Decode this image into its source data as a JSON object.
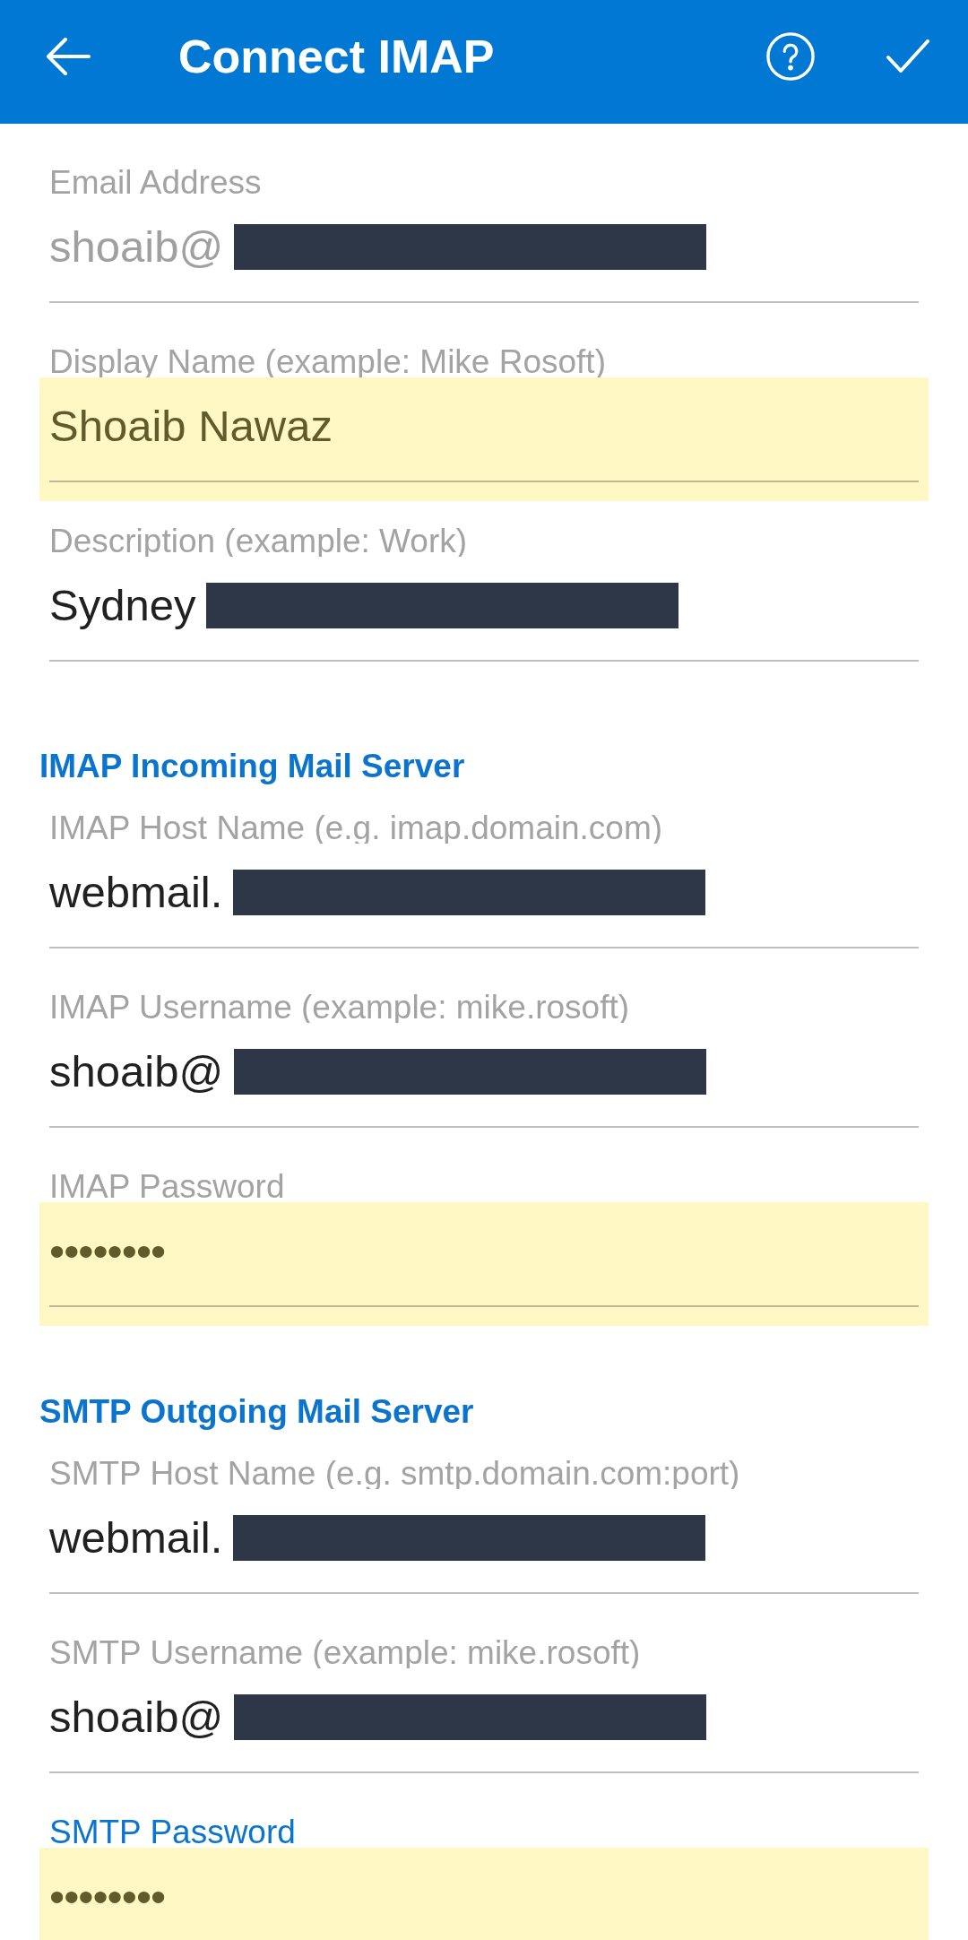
{
  "app_bar": {
    "title": "Connect IMAP"
  },
  "sections": [
    {
      "fields": [
        {
          "label": "Email Address",
          "value": "shoaib@",
          "kind": "text",
          "disabled": true,
          "autofilled": false,
          "focused": false,
          "redacted": true
        },
        {
          "label": "Display Name (example: Mike Rosoft)",
          "value": "Shoaib Nawaz",
          "kind": "text",
          "disabled": false,
          "autofilled": true,
          "focused": false,
          "redacted": false
        },
        {
          "label": "Description (example: Work)",
          "value": "Sydney",
          "kind": "text",
          "disabled": false,
          "autofilled": false,
          "focused": false,
          "redacted": true
        }
      ]
    },
    {
      "heading": "IMAP Incoming Mail Server",
      "fields": [
        {
          "label": "IMAP Host Name (e.g. imap.domain.com)",
          "value": "webmail.",
          "kind": "text",
          "disabled": false,
          "autofilled": false,
          "focused": false,
          "redacted": true
        },
        {
          "label": "IMAP Username (example: mike.rosoft)",
          "value": "shoaib@",
          "kind": "text",
          "disabled": false,
          "autofilled": false,
          "focused": false,
          "redacted": true
        },
        {
          "label": "IMAP Password",
          "value": "••••••••",
          "kind": "password",
          "disabled": false,
          "autofilled": true,
          "focused": false,
          "redacted": false
        }
      ]
    },
    {
      "heading": "SMTP Outgoing Mail Server",
      "fields": [
        {
          "label": "SMTP Host Name (e.g. smtp.domain.com:port)",
          "value": "webmail.",
          "kind": "text",
          "disabled": false,
          "autofilled": false,
          "focused": false,
          "redacted": true
        },
        {
          "label": "SMTP Username (example: mike.rosoft)",
          "value": "shoaib@",
          "kind": "text",
          "disabled": false,
          "autofilled": false,
          "focused": false,
          "redacted": true
        },
        {
          "label": "SMTP Password",
          "value": "••••••••",
          "kind": "password",
          "disabled": false,
          "autofilled": true,
          "focused": true,
          "redacted": false
        }
      ]
    }
  ]
}
